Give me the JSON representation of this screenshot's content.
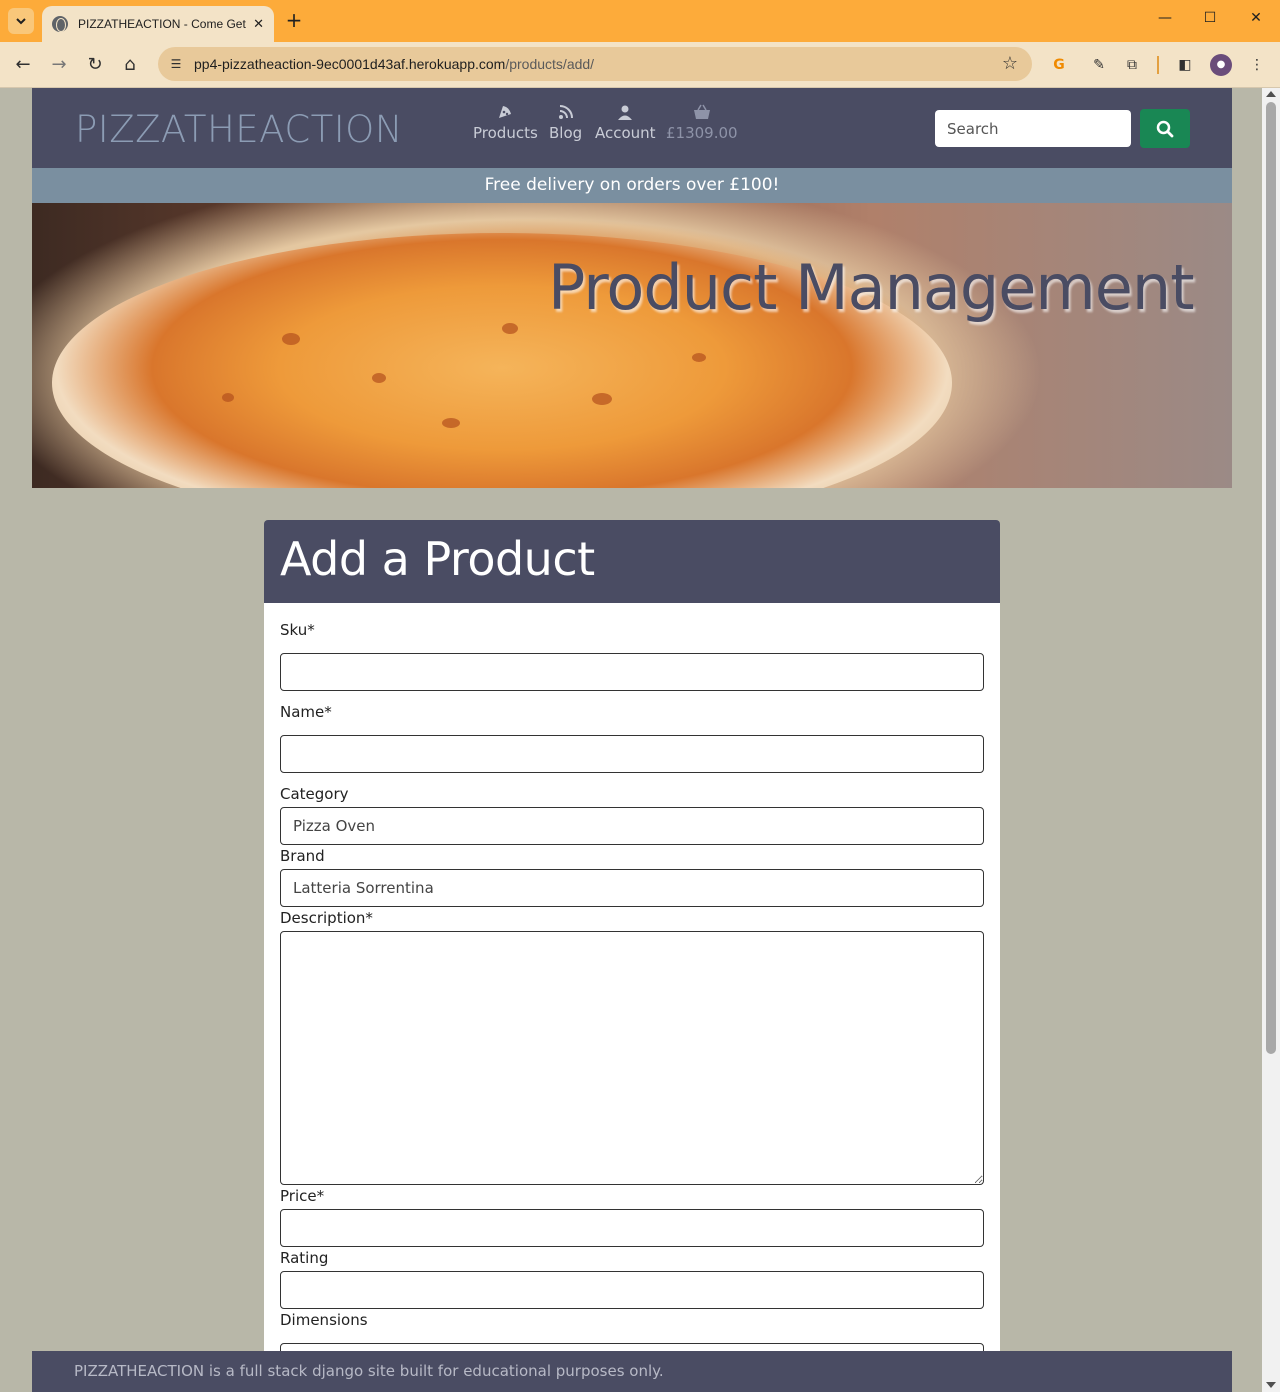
{
  "browser": {
    "tab_title": "PIZZATHEACTION - Come Get Some Pizza",
    "url_host": "pp4-pizzatheaction-9ec0001d43af.herokuapp.com",
    "url_path": "/products/add/"
  },
  "header": {
    "brand": "PIZZATHEACTION",
    "nav": [
      {
        "label": "Products",
        "icon": "pizza-slice-icon"
      },
      {
        "label": "Blog",
        "icon": "rss-icon"
      },
      {
        "label": "Account",
        "icon": "user-icon"
      },
      {
        "label": "£1309.00",
        "icon": "basket-icon"
      }
    ],
    "search_placeholder": "Search"
  },
  "banner": {
    "text": "Free delivery on orders over £100!"
  },
  "hero": {
    "title": "Product Management"
  },
  "form": {
    "title": "Add a Product",
    "fields": {
      "sku_label": "Sku*",
      "name_label": "Name*",
      "category_label": "Category",
      "category_value": "Pizza Oven",
      "brand_label": "Brand",
      "brand_value": "Latteria Sorrentina",
      "description_label": "Description*",
      "price_label": "Price*",
      "rating_label": "Rating",
      "dimensions_label": "Dimensions"
    }
  },
  "footer": {
    "text": "PIZZATHEACTION is a full stack django site built for educational purposes only."
  },
  "colors": {
    "header_bg": "#4a4c63",
    "banner_bg": "#7a8fa0",
    "search_button": "#198754",
    "page_bg": "#b8b7a8",
    "browser_accent": "#fdab3a"
  }
}
